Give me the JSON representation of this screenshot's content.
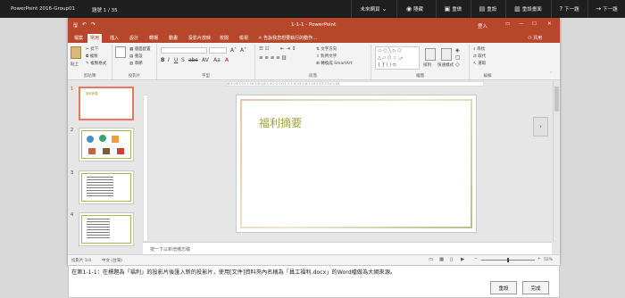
{
  "exam": {
    "title": "PowerPoint 2016-Group01",
    "question": "題號 1 / 35",
    "taskguide": "未來網頁",
    "buttons": {
      "hide": "隱藏",
      "restart": "重做",
      "reset": "重設",
      "reset_view": "重設畫面",
      "next": "下一題"
    }
  },
  "window": {
    "app_title": "1-1-1 - PowerPoint",
    "signin": "登入",
    "share": "共用"
  },
  "ribbon_tabs": [
    "檔案",
    "常用",
    "插入",
    "設計",
    "轉場",
    "動畫",
    "投影片放映",
    "校閱",
    "檢視"
  ],
  "tellme": "告訴我您想要執行的動作…",
  "groups": {
    "clipboard": "剪貼簿",
    "slides": "投影片",
    "font": "字型",
    "paragraph": "段落",
    "drawing": "繪圖",
    "editing": "編輯",
    "paste": "貼上",
    "new_slide": "新增\n投影片",
    "layout": "版面配置",
    "reset": "重設",
    "section": "章節",
    "cut": "剪下",
    "copy": "複製",
    "format_painter": "複製格式",
    "text_direction": "文字方向",
    "align_text": "對齊文字",
    "smartart": "轉換成 SmartArt",
    "arrange": "排列",
    "quick_styles": "快速樣式",
    "find": "尋找",
    "replace": "取代",
    "select": "選取"
  },
  "thumbnails": [
    {
      "num": "1",
      "title": "福利摘要",
      "selected": true
    },
    {
      "num": "2",
      "title": "",
      "selected": false
    },
    {
      "num": "3",
      "title": "",
      "selected": false
    },
    {
      "num": "4",
      "title": "",
      "selected": false
    }
  ],
  "slide": {
    "title": "福利摘要"
  },
  "ruler": "16·1·14·1·12·1·10·1·8·1·6·1·4·1·2·1·0·1·2·1·4·1·6·1·8·1·10·1·12·1·14·1·16",
  "notes_placeholder": "按一下以新增備忘稿",
  "status": {
    "slide_info": "投影片 1/4",
    "language": "中文 (台灣)",
    "zoom": "52%"
  },
  "instruction": {
    "text": "在第1-1-1：在標題為「福利」的投影片後匯入新的投影片，使用[文件]資料夾內名稱為「員工福利.docx」的Word檔做為大綱來源。",
    "reset_btn": "重設",
    "done_btn": "完成"
  }
}
